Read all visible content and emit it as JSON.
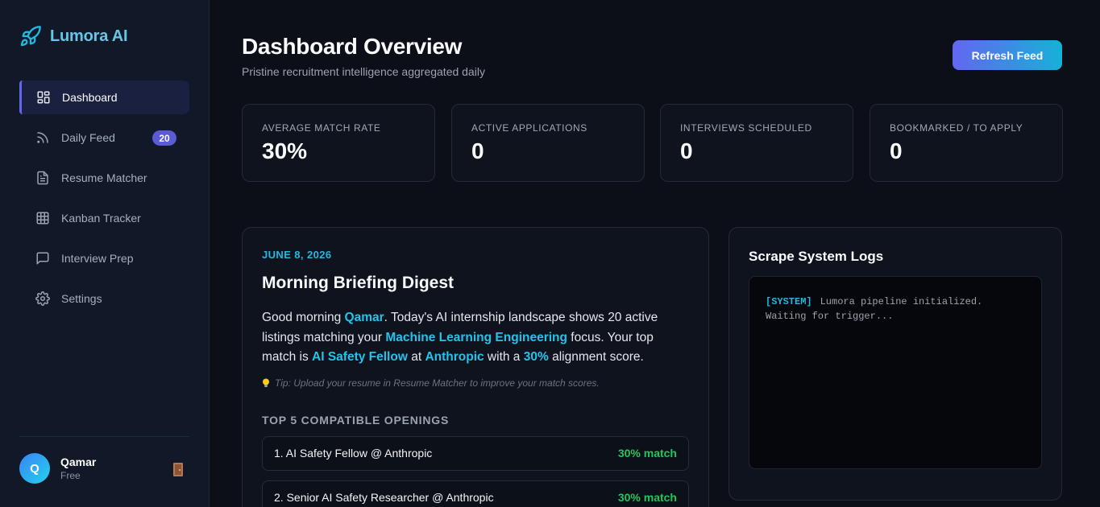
{
  "brand": {
    "name": "Lumora AI"
  },
  "sidebar": {
    "items": [
      {
        "label": "Dashboard",
        "icon": "dashboard-icon",
        "active": true
      },
      {
        "label": "Daily Feed",
        "icon": "rss-icon",
        "badge": "20"
      },
      {
        "label": "Resume Matcher",
        "icon": "document-icon"
      },
      {
        "label": "Kanban Tracker",
        "icon": "grid-icon"
      },
      {
        "label": "Interview Prep",
        "icon": "chat-icon"
      },
      {
        "label": "Settings",
        "icon": "gear-icon"
      }
    ]
  },
  "user": {
    "initial": "Q",
    "name": "Qamar",
    "plan": "Free"
  },
  "header": {
    "title": "Dashboard Overview",
    "subtitle": "Pristine recruitment intelligence aggregated daily",
    "refresh_label": "Refresh Feed"
  },
  "stats": [
    {
      "label": "AVERAGE MATCH RATE",
      "value": "30%"
    },
    {
      "label": "ACTIVE APPLICATIONS",
      "value": "0"
    },
    {
      "label": "INTERVIEWS SCHEDULED",
      "value": "0"
    },
    {
      "label": "BOOKMARKED / TO APPLY",
      "value": "0"
    }
  ],
  "digest": {
    "date": "JUNE 8, 2026",
    "title": "Morning Briefing Digest",
    "body": {
      "p1": "Good morning ",
      "name": "Qamar",
      "p2": ". Today's AI internship landscape shows 20 active listings matching your ",
      "focus": "Machine Learning Engineering",
      "p3": " focus. Your top match is ",
      "role": "AI Safety Fellow",
      "p4": " at ",
      "company": "Anthropic",
      "p5": " with a ",
      "score": "30%",
      "p6": " alignment score."
    },
    "tip": "Tip: Upload your resume in Resume Matcher to improve your match scores.",
    "section_title": "TOP 5 COMPATIBLE OPENINGS",
    "openings": [
      {
        "title": "1. AI Safety Fellow @ Anthropic",
        "match": "30% match"
      },
      {
        "title": "2. Senior AI Safety Researcher @ Anthropic",
        "match": "30% match"
      }
    ]
  },
  "logs": {
    "title": "Scrape System Logs",
    "lines": [
      {
        "tag": "[SYSTEM]",
        "text": "Lumora pipeline initialized."
      },
      {
        "tag": "",
        "text": "Waiting for trigger..."
      }
    ]
  },
  "colors": {
    "accent": "#6366f1",
    "highlight": "#22c4ee",
    "match": "#22c55e"
  }
}
